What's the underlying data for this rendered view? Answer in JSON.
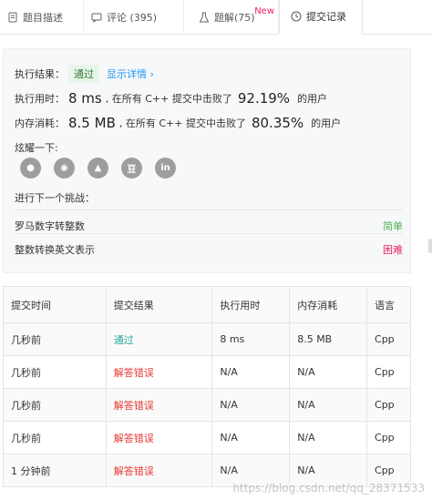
{
  "tabs": [
    {
      "label": "题目描述",
      "icon": "document-icon"
    },
    {
      "label": "评论 (395)",
      "icon": "comment-icon"
    },
    {
      "label": "题解(75)",
      "icon": "flask-icon",
      "badge": "New"
    },
    {
      "label": "提交记录",
      "icon": "clock-icon"
    }
  ],
  "result": {
    "status_label": "执行结果：",
    "status": "通过",
    "details_link": "显示详情 ›",
    "runtime_label": "执行用时：",
    "runtime_value": "8 ms",
    "runtime_mid": ", 在所有 C++ 提交中击败了",
    "runtime_pct": "92.19%",
    "runtime_tail": "的用户",
    "memory_label": "内存消耗：",
    "memory_value": "8.5 MB",
    "memory_mid": ", 在所有 C++ 提交中击败了",
    "memory_pct": "80.35%",
    "memory_tail": "的用户",
    "share_label": "炫耀一下:",
    "share_icons": [
      "wechat-icon",
      "weibo-icon",
      "qq-icon",
      "douban-icon",
      "linkedin-icon"
    ],
    "share_glyphs": [
      "●",
      "◉",
      "▲",
      "豆",
      "in"
    ],
    "next_label": "进行下一个挑战：",
    "challenges": [
      {
        "title": "罗马数字转整数",
        "difficulty": "简单",
        "level": "easy"
      },
      {
        "title": "整数转换英文表示",
        "difficulty": "困难",
        "level": "hard"
      }
    ]
  },
  "table": {
    "headers": [
      "提交时间",
      "提交结果",
      "执行用时",
      "内存消耗",
      "语言"
    ],
    "rows": [
      {
        "time": "几秒前",
        "result": "通过",
        "ok": true,
        "runtime": "8 ms",
        "memory": "8.5 MB",
        "lang": "Cpp"
      },
      {
        "time": "几秒前",
        "result": "解答错误",
        "ok": false,
        "runtime": "N/A",
        "memory": "N/A",
        "lang": "Cpp"
      },
      {
        "time": "几秒前",
        "result": "解答错误",
        "ok": false,
        "runtime": "N/A",
        "memory": "N/A",
        "lang": "Cpp"
      },
      {
        "time": "几秒前",
        "result": "解答错误",
        "ok": false,
        "runtime": "N/A",
        "memory": "N/A",
        "lang": "Cpp"
      },
      {
        "time": "1 分钟前",
        "result": "解答错误",
        "ok": false,
        "runtime": "N/A",
        "memory": "N/A",
        "lang": "Cpp"
      }
    ]
  },
  "watermark": "https://blog.csdn.net/qq_28371533",
  "colors": {
    "pass": "#26a69a",
    "error": "#e53935",
    "easy": "#4caf50",
    "hard": "#e91e63",
    "new": "#e91e63"
  }
}
